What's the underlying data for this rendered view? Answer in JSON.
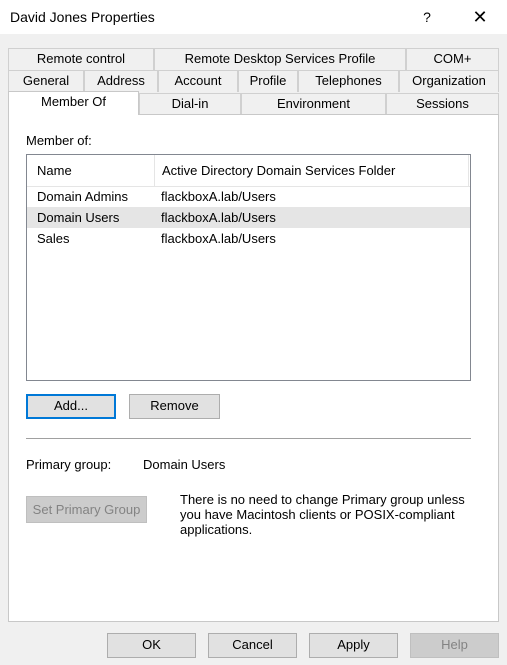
{
  "window": {
    "title": "David Jones Properties",
    "help_glyph": "?",
    "close_glyph": "✕"
  },
  "tabs": {
    "row1": [
      "Remote control",
      "Remote Desktop Services Profile",
      "COM+"
    ],
    "row2": [
      "General",
      "Address",
      "Account",
      "Profile",
      "Telephones",
      "Organization"
    ],
    "row3": [
      "Member Of",
      "Dial-in",
      "Environment",
      "Sessions"
    ],
    "active": "Member Of"
  },
  "member_of": {
    "label": "Member of:",
    "columns": [
      "Name",
      "Active Directory Domain Services Folder"
    ],
    "rows": [
      {
        "name": "Domain Admins",
        "folder": "flackboxA.lab/Users"
      },
      {
        "name": "Domain Users",
        "folder": "flackboxA.lab/Users"
      },
      {
        "name": "Sales",
        "folder": "flackboxA.lab/Users"
      }
    ],
    "selected_row": "Domain Users"
  },
  "buttons": {
    "add": "Add...",
    "remove": "Remove",
    "set_primary": "Set Primary Group"
  },
  "primary_group": {
    "label": "Primary group:",
    "value": "Domain Users",
    "info": "There is no need to change Primary group unless you have Macintosh clients or POSIX-compliant applications."
  },
  "footer": {
    "ok": "OK",
    "cancel": "Cancel",
    "apply": "Apply",
    "help": "Help"
  },
  "colors": {
    "focus_border": "#0078d7",
    "selection": "#e5e5e5",
    "dialog_bg": "#f0f0f0"
  }
}
